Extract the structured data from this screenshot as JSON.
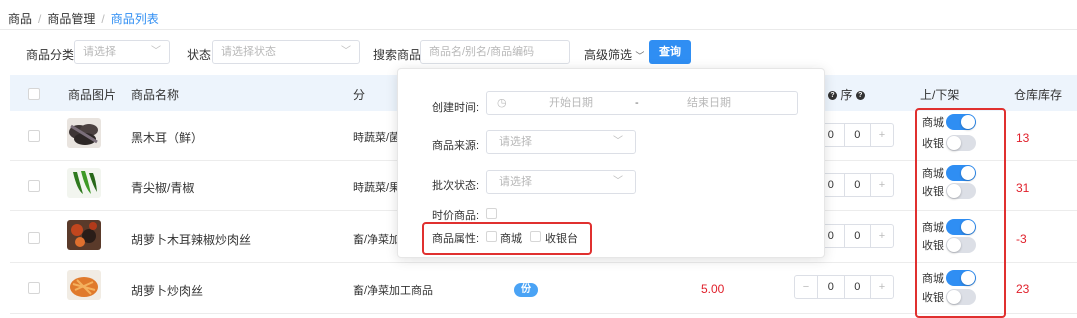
{
  "breadcrumb": {
    "items": [
      "商品",
      "商品管理"
    ],
    "current": "商品列表"
  },
  "filters": {
    "category": {
      "label": "商品分类:",
      "placeholder": "请选择"
    },
    "status": {
      "label": "状态:",
      "placeholder": "请选择状态"
    },
    "search": {
      "label": "搜索商品:",
      "placeholder": "商品名/别名/商品编码"
    },
    "advanced_label": "高级筛选",
    "query_label": "查询"
  },
  "table": {
    "headers": {
      "image": "商品图片",
      "name": "商品名称",
      "category": "分",
      "sort": "序",
      "updown": "上/下架",
      "stock": "仓库库存"
    },
    "toggle_labels": {
      "mall": "商城",
      "pos": "收银"
    },
    "rows": [
      {
        "name": "黑木耳（鲜）",
        "category": "時蔬菜/菌",
        "sort_a": "0",
        "sort_b": "0",
        "stock": "13",
        "mall_on": true,
        "pos_on": false
      },
      {
        "name": "青尖椒/青椒",
        "category": "時蔬菜/果",
        "sort_a": "0",
        "sort_b": "0",
        "stock": "31",
        "mall_on": true,
        "pos_on": false
      },
      {
        "name": "胡萝卜木耳辣椒炒肉丝",
        "category": "畜/净菜加",
        "sort_a": "0",
        "sort_b": "0",
        "stock": "-3",
        "mall_on": true,
        "pos_on": false
      },
      {
        "name": "胡萝卜炒肉丝",
        "category": "畜/净菜加工商品",
        "price": "5.00",
        "badge": "份",
        "sort_a": "0",
        "sort_b": "0",
        "stock": "23",
        "mall_on": true,
        "pos_on": false
      }
    ]
  },
  "popover": {
    "created_label": "创建时间:",
    "start_placeholder": "开始日期",
    "range_sep": "-",
    "end_placeholder": "结束日期",
    "source_label": "商品来源:",
    "source_placeholder": "请选择",
    "batch_label": "批次状态:",
    "batch_placeholder": "请选择",
    "seasonal_label": "时价商品:",
    "attr_label": "商品属性:",
    "attr_mall": "商城",
    "attr_pos": "收银台"
  },
  "icons": {
    "clock": "clock-icon",
    "chevron": "chevron-down-icon",
    "help": "question-icon"
  },
  "colors": {
    "primary": "#2f8ef3",
    "header_bg": "#edf4fc",
    "stock_red": "#e0202b",
    "highlight_red": "#e0302f"
  }
}
